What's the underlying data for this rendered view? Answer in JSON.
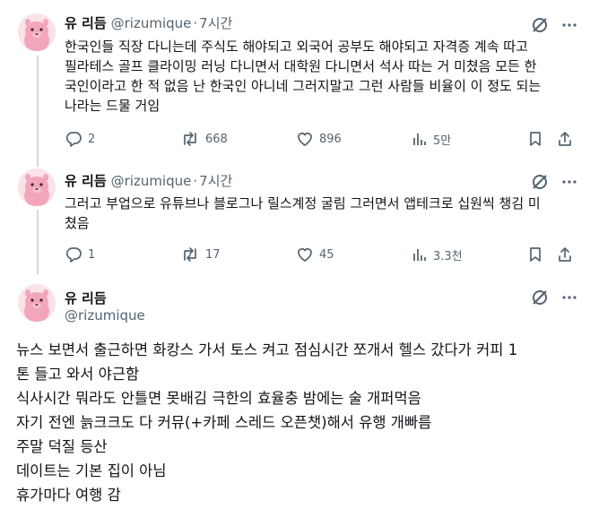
{
  "tweets": [
    {
      "author": "유 리듬",
      "handle": "@rizumique",
      "separator": "·",
      "time": "7시간",
      "lines": [
        "한국인들 직장 다니는데 주식도 해야되고 외국어 공부도 해야되고 자격증 계속 따고",
        "필라테스 골프 클라이밍 러닝 다니면서 대학원 다니면서 석사 따는 거 미쳤음 모든 한",
        "국인이라고 한 적 없음 난 한국인 아니네 그러지말고 그런 사람들 비율이 이 정도 되는",
        "나라는 드물 거임"
      ],
      "replies": "2",
      "retweets": "668",
      "likes": "896",
      "views": "5만"
    },
    {
      "author": "유 리듬",
      "handle": "@rizumique",
      "separator": "·",
      "time": "7시간",
      "lines": [
        "그러고 부업으로 유튜브나 블로그나 릴스계정 굴림 그러면서 앱테크로 십원씩 챙김 미",
        "쳤음"
      ],
      "replies": "1",
      "retweets": "17",
      "likes": "45",
      "views": "3.3천"
    }
  ],
  "main_tweet": {
    "author": "유 리듬",
    "handle": "@rizumique",
    "lines": [
      "뉴스 보면서 출근하면 화캉스 가서 토스 켜고 점심시간 쪼개서 헬스 갔다가 커피 1",
      "톤 들고 와서 야근함",
      "식사시간 뭐라도 안틀면 못배김 극한의 효율충 밤에는 술 개퍼먹음",
      "자기 전엔 늙크크도 다 커뮤(+카페 스레드 오픈챗)해서 유행 개빠름",
      "주말 덕질 등산",
      "데이트는 기본 집이 아님",
      "휴가마다 여행 감"
    ]
  },
  "icons": {
    "grok": "grok-icon",
    "more": "more-icon",
    "reply": "reply-icon",
    "retweet": "retweet-icon",
    "like": "like-icon",
    "views": "views-icon",
    "bookmark": "bookmark-icon",
    "share": "share-icon"
  },
  "colors": {
    "text": "#0f1419",
    "secondary": "#536471",
    "thread_line": "#cfd9de",
    "avatar_bg": "#f7dbe2",
    "avatar_character": "#f3a6b9"
  }
}
